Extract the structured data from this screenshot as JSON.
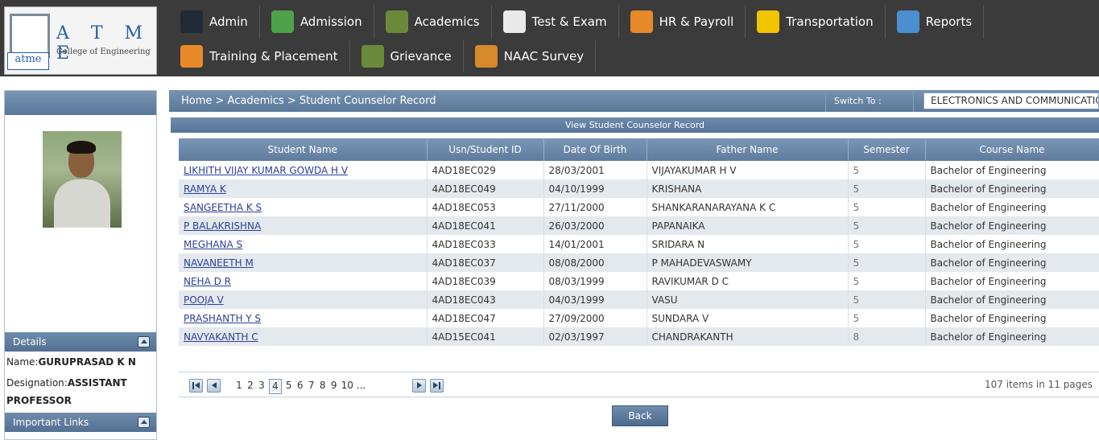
{
  "logo": {
    "letters": "A T M E",
    "college": "College of Engineering",
    "mini": "atme"
  },
  "menu": {
    "row1": [
      {
        "label": "Admin",
        "icon": "admin-icon",
        "color": "#1f2a36"
      },
      {
        "label": "Admission",
        "icon": "admission-icon",
        "color": "#4fa24a"
      },
      {
        "label": "Academics",
        "icon": "books-icon",
        "color": "#6a8a3a"
      },
      {
        "label": "Test & Exam",
        "icon": "notepad-icon",
        "color": "#e9e9e9"
      },
      {
        "label": "HR & Payroll",
        "icon": "person-icon",
        "color": "#e88a2a"
      },
      {
        "label": "Transportation",
        "icon": "bus-sign-icon",
        "color": "#f2c400"
      },
      {
        "label": "Reports",
        "icon": "presentation-icon",
        "color": "#4a8fd0"
      }
    ],
    "row2": [
      {
        "label": "Training & Placement",
        "icon": "person-icon",
        "color": "#e88a2a"
      },
      {
        "label": "Grievance",
        "icon": "books-icon",
        "color": "#6a8a3a"
      },
      {
        "label": "NAAC Survey",
        "icon": "magnifier-person-icon",
        "color": "#d68a2a"
      }
    ]
  },
  "sidebar": {
    "details_label": "Details",
    "name_prefix": "Name:",
    "name_value": "GURUPRASAD K N",
    "designation_prefix": "Designation:",
    "designation_value": "ASSISTANT",
    "designation_value2": "PROFESSOR",
    "links_label": "Important Links"
  },
  "breadcrumb": "Home > Academics > Student Counselor Record",
  "switch": {
    "label": "Switch To :",
    "value": "ELECTRONICS AND COMMUNICATION"
  },
  "grid": {
    "title": "View Student Counselor Record",
    "headers": [
      "Student Name",
      "Usn/Student ID",
      "Date Of Birth",
      "Father Name",
      "Semester",
      "Course Name"
    ],
    "rows": [
      [
        "LIKHITH VIJAY KUMAR GOWDA H V",
        "4AD18EC029",
        "28/03/2001",
        "VIJAYAKUMAR H V",
        "5",
        "Bachelor of Engineering"
      ],
      [
        "RAMYA K",
        "4AD18EC049",
        "04/10/1999",
        "KRISHANA",
        "5",
        "Bachelor of Engineering"
      ],
      [
        "SANGEETHA K S",
        "4AD18EC053",
        "27/11/2000",
        "SHANKARANARAYANA K C",
        "5",
        "Bachelor of Engineering"
      ],
      [
        "P BALAKRISHNA",
        "4AD18EC041",
        "26/03/2000",
        "PAPANAIKA",
        "5",
        "Bachelor of Engineering"
      ],
      [
        "MEGHANA S",
        "4AD18EC033",
        "14/01/2001",
        "SRIDARA N",
        "5",
        "Bachelor of Engineering"
      ],
      [
        "NAVANEETH M",
        "4AD18EC037",
        "08/08/2000",
        "P MAHADEVASWAMY",
        "5",
        "Bachelor of Engineering"
      ],
      [
        "NEHA D R",
        "4AD18EC039",
        "08/03/1999",
        "RAVIKUMAR D C",
        "5",
        "Bachelor of Engineering"
      ],
      [
        "POOJA V",
        "4AD18EC043",
        "04/03/1999",
        "VASU",
        "5",
        "Bachelor of Engineering"
      ],
      [
        "PRASHANTH Y S",
        "4AD18EC047",
        "27/09/2000",
        "SUNDARA V",
        "5",
        "Bachelor of Engineering"
      ],
      [
        "NAVYAKANTH C",
        "4AD15EC041",
        "02/03/1997",
        "CHANDRAKANTH",
        "8",
        "Bachelor of Engineering"
      ]
    ]
  },
  "pager": {
    "pages": [
      "1",
      "2",
      "3",
      "4",
      "5",
      "6",
      "7",
      "8",
      "9",
      "10",
      "..."
    ],
    "current": "4",
    "info": "107 items in 11 pages"
  },
  "back_label": "Back",
  "colors": {
    "header_dark": "#3b3b3b",
    "bar_blue": "#5b7898",
    "link": "#2b3f9c",
    "alt_row": "#e4e9ee"
  }
}
